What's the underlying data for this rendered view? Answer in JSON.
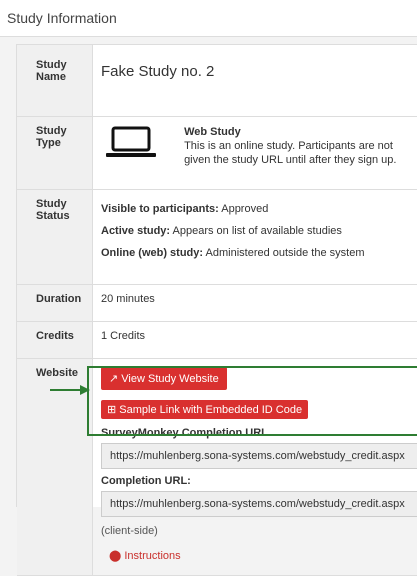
{
  "panel": {
    "title": "Study Information"
  },
  "study": {
    "name_label": "Study Name",
    "name": "Fake Study no. 2",
    "type_label": "Study Type",
    "type_title": "Web Study",
    "type_desc": "This is an online study. Participants are not given the study URL until after they sign up.",
    "status_label": "Study Status",
    "visible_label": "Visible to participants:",
    "visible_value": "Approved",
    "active_label": "Active study:",
    "active_value": "Appears on list of available studies",
    "online_label": "Online (web) study:",
    "online_value": "Administered outside the system",
    "duration_label": "Duration",
    "duration": "20 minutes",
    "credits_label": "Credits",
    "credits": "1 Credits",
    "website_label": "Website",
    "view_button": "View Study Website",
    "sample_button": "Sample Link with Embedded ID Code",
    "sm_heading": "SurveyMonkey Completion URL",
    "sm_url": "https://muhlenberg.sona-systems.com/webstudy_credit.aspx",
    "completion_heading": "Completion URL:",
    "completion_url": "https://muhlenberg.sona-systems.com/webstudy_credit.aspx",
    "client_side": "(client-side)",
    "instructions": "Instructions"
  },
  "icons": {
    "laptop": "laptop-icon",
    "external": "external-link-icon",
    "code": "code-icon",
    "info": "info-icon"
  },
  "colors": {
    "button": "#d9302f",
    "highlight": "#2e7d32"
  }
}
